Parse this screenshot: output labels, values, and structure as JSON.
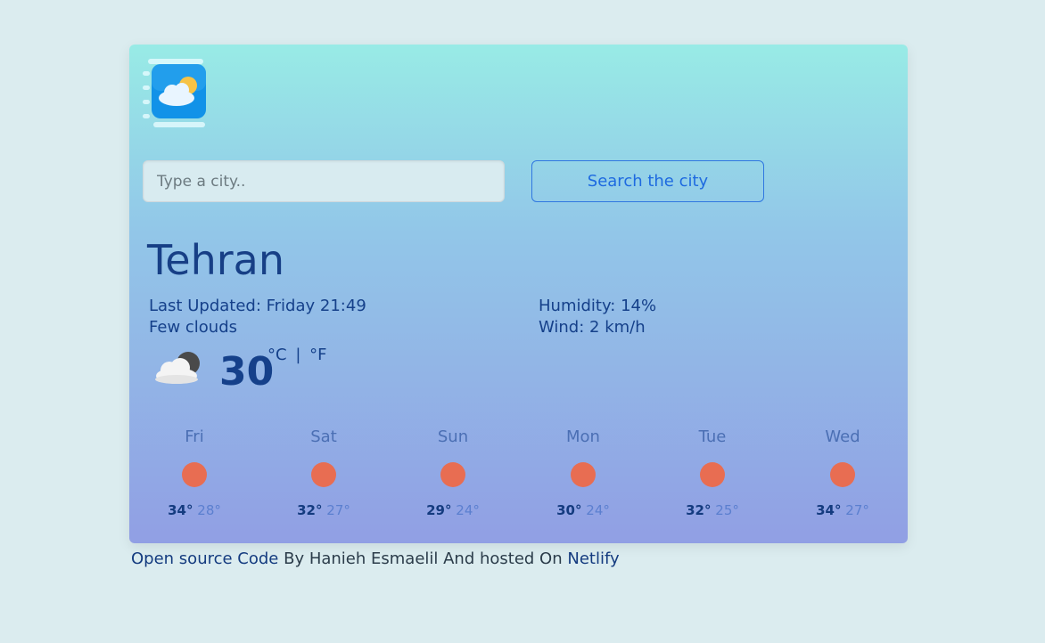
{
  "search": {
    "placeholder": "Type a city..",
    "button_label": "Search the city"
  },
  "current": {
    "city": "Tehran",
    "last_updated": "Last Updated: Friday 21:49",
    "description": "Few clouds",
    "humidity": "Humidity: 14%",
    "wind": "Wind: 2 km/h",
    "temperature": "30",
    "unit_c": "°C",
    "unit_separator": "|",
    "unit_f": "°F",
    "icon": "few-clouds-night-icon"
  },
  "forecast": [
    {
      "day": "Fri",
      "max": "34°",
      "min": "28°",
      "icon": "sun-icon"
    },
    {
      "day": "Sat",
      "max": "32°",
      "min": "27°",
      "icon": "sun-icon"
    },
    {
      "day": "Sun",
      "max": "29°",
      "min": "24°",
      "icon": "sun-icon"
    },
    {
      "day": "Mon",
      "max": "30°",
      "min": "24°",
      "icon": "sun-icon"
    },
    {
      "day": "Tue",
      "max": "32°",
      "min": "25°",
      "icon": "sun-icon"
    },
    {
      "day": "Wed",
      "max": "34°",
      "min": "27°",
      "icon": "sun-icon"
    }
  ],
  "footer": {
    "source_link": "Open source Code",
    "by_text": " By Hanieh Esmaelil And hosted On ",
    "host_link": "Netlify"
  },
  "colors": {
    "accent": "#1e6ae0",
    "sun": "#e86d52",
    "text_dark": "#15408a"
  }
}
